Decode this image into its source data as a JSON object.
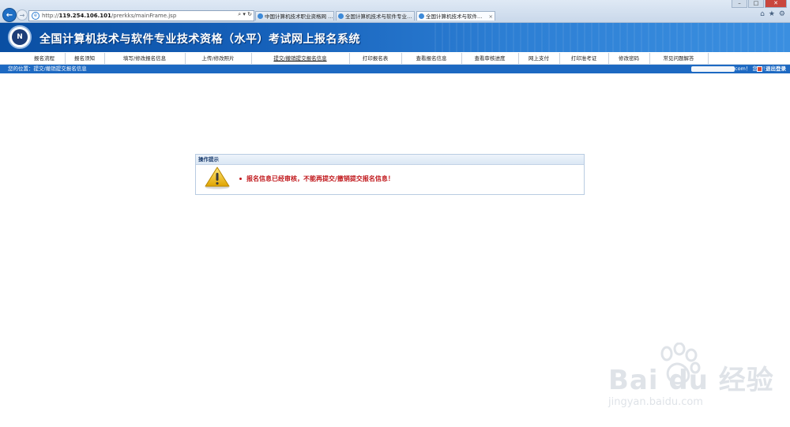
{
  "browser": {
    "url_prefix": "http://",
    "url_host": "119.254.106.101",
    "url_path": "/prerkks/mainFrame.jsp",
    "address_tools": "⌕ ▾ ↻",
    "tabs": [
      {
        "title": "中国计算机技术职业资格网 | ..."
      },
      {
        "title": "全国计算机技术与软件专业技..."
      },
      {
        "title": "全国计算机技术与软件专业...",
        "active": true
      }
    ],
    "tab_close": "×"
  },
  "banner": {
    "title": "全国计算机技术与软件专业技术资格（水平）考试网上报名系统"
  },
  "menu": [
    "报名流程",
    "报名须知",
    "填写/修改报名信息",
    "上传/修改照片",
    "提交/撤销提交报名信息",
    "打印报名表",
    "查看报名信息",
    "查看审核进度",
    "网上支付",
    "打印准考证",
    "修改密码",
    "常见问题解答"
  ],
  "status": {
    "breadcrumb": "您的位置：提交/撤销提交报名信息",
    "greeting": "com！ 您好！",
    "logout": "退出登录"
  },
  "panel": {
    "header": "操作提示",
    "message": "报名信息已经审核，不能再提交/撤销提交报名信息！",
    "icon": "warning-icon"
  },
  "watermark": {
    "brand": "Bai du 经验",
    "site": "jingyan.baidu.com"
  },
  "colors": {
    "banner": "#1762bb",
    "status_bar": "#1d69c2",
    "message": "#c0171b"
  }
}
